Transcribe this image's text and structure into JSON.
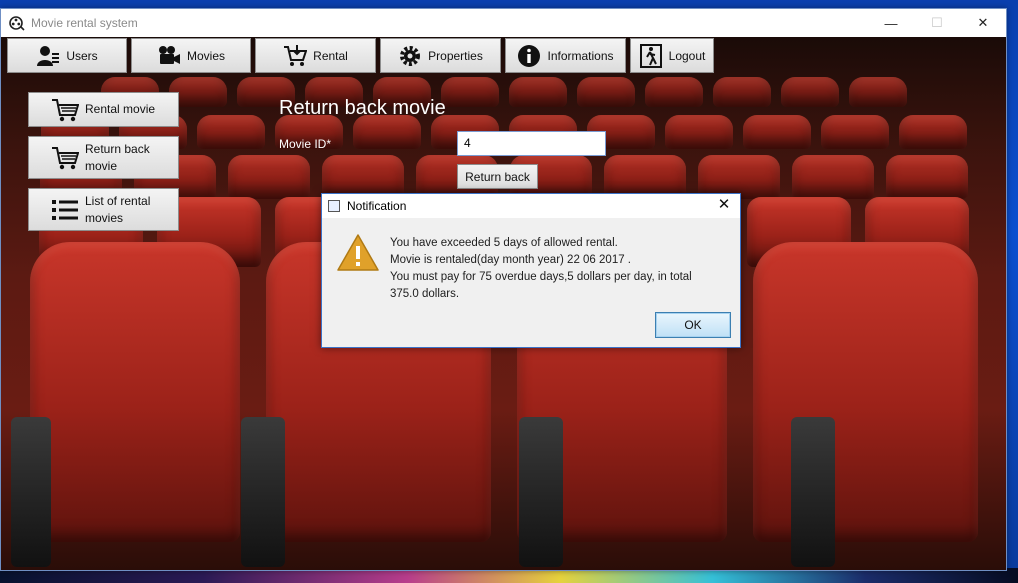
{
  "window": {
    "title": "Movie rental system",
    "minimize": "—",
    "restore": "☐",
    "close": "✕"
  },
  "nav": {
    "users": "Users",
    "movies": "Movies",
    "rental": "Rental",
    "properties": "Properties",
    "informations": "Informations",
    "logout": "Logout"
  },
  "sidebar": {
    "items": [
      {
        "label": "Rental movie"
      },
      {
        "label_line1": "Return back",
        "label_line2": "movie"
      },
      {
        "label_line1": "List of rental",
        "label_line2": "movies"
      }
    ]
  },
  "panel": {
    "title": "Return back movie",
    "movie_id_label": "Movie ID*",
    "movie_id_value": "4",
    "return_button": "Return back"
  },
  "dialog": {
    "title": "Notification",
    "close": "✕",
    "line1": "You have exceeded 5 days of allowed rental.",
    "line2": "Movie is rentaled(day month year) 22 06 2017 .",
    "line3": "You must pay for 75 overdue days,5 dollars per day, in total",
    "line4": "375.0 dollars.",
    "ok": "OK"
  },
  "colors": {
    "accent": "#3b73c8",
    "seat_red": "#b02a1f",
    "warning": "#e0a12a"
  }
}
